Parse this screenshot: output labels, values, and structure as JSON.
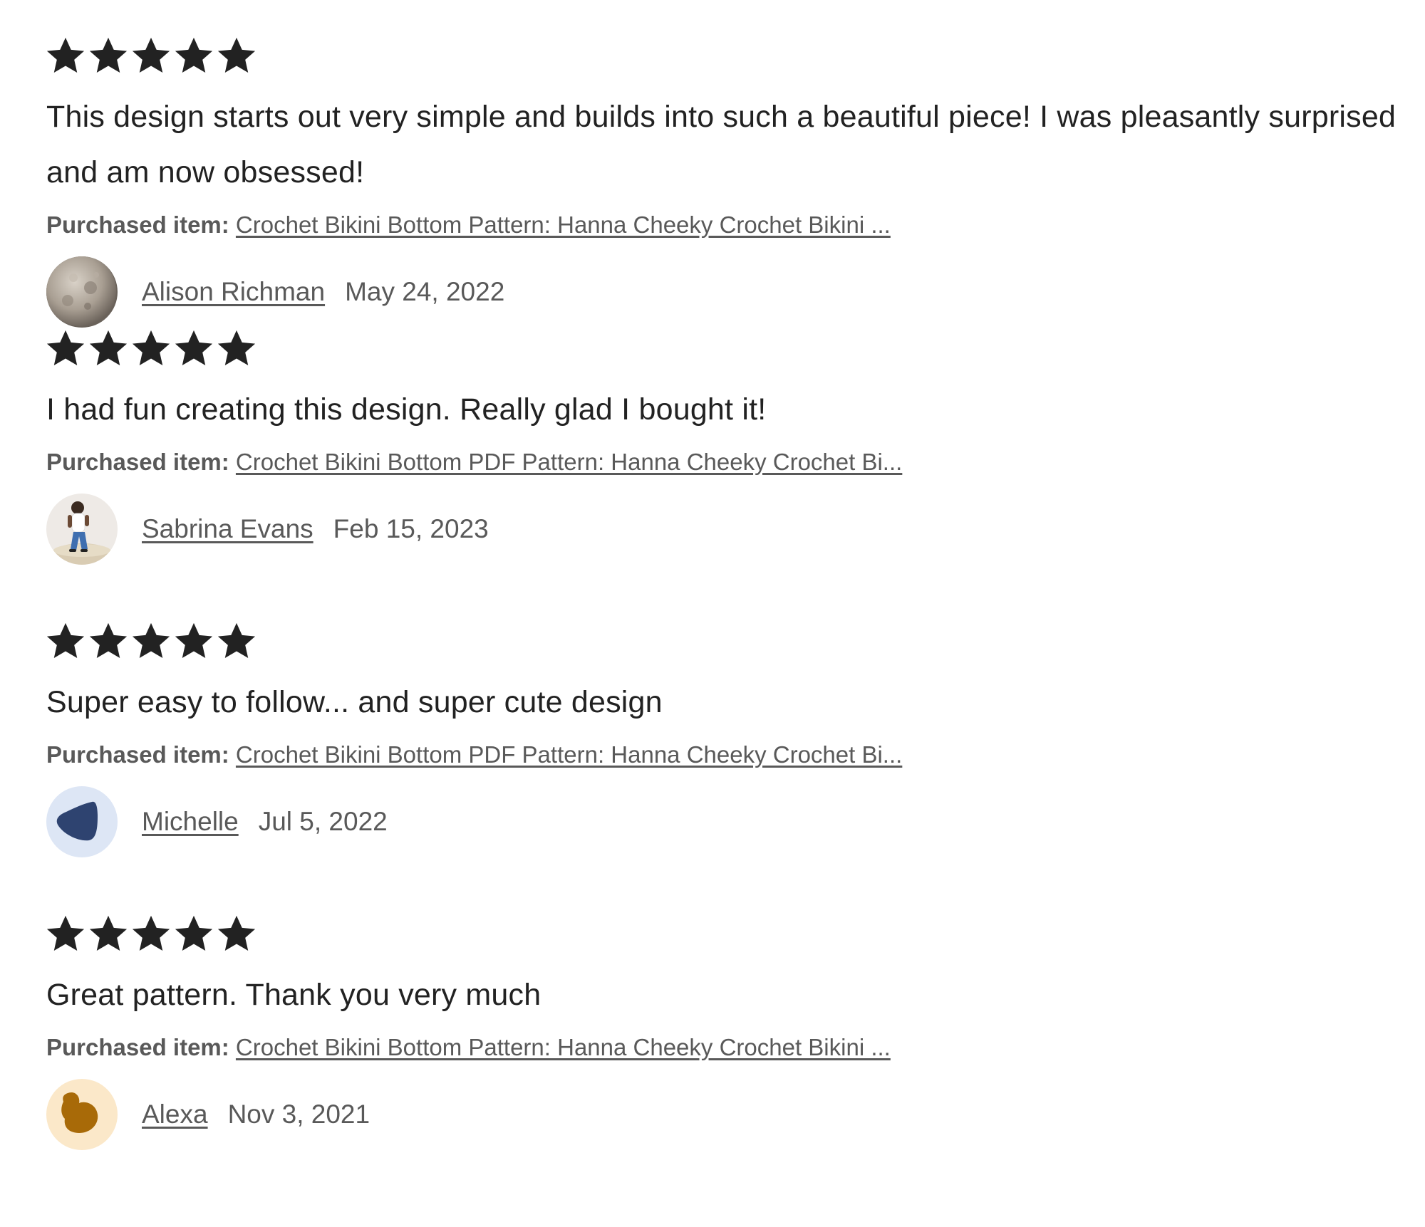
{
  "purchased_label": "Purchased item:",
  "colors": {
    "star": "#222222",
    "text": "#222222",
    "secondary": "#595959"
  },
  "reviews": [
    {
      "rating": 5,
      "text": "This design starts out very simple and builds into such a beautiful piece! I was pleasantly surprised and am now obsessed!",
      "purchased_item": "Crochet Bikini Bottom Pattern: Hanna Cheeky Crochet Bikini ...",
      "reviewer": "Alison Richman",
      "date": "May 24, 2022",
      "avatar": "moon-photo-avatar"
    },
    {
      "rating": 5,
      "text": "I had fun creating this design. Really glad I bought it!",
      "purchased_item": "Crochet Bikini Bottom PDF Pattern: Hanna Cheeky Crochet Bi...",
      "reviewer": "Sabrina Evans",
      "date": "Feb 15, 2023",
      "avatar": "person-photo-avatar"
    },
    {
      "rating": 5,
      "text": "Super easy to follow... and super cute design",
      "purchased_item": "Crochet Bikini Bottom PDF Pattern: Hanna Cheeky Crochet Bi...",
      "reviewer": "Michelle",
      "date": "Jul 5, 2022",
      "avatar": "blue-blob-avatar"
    },
    {
      "rating": 5,
      "text": "Great pattern. Thank you very much",
      "purchased_item": "Crochet Bikini Bottom Pattern: Hanna Cheeky Crochet Bikini ...",
      "reviewer": "Alexa",
      "date": "Nov 3, 2021",
      "avatar": "brown-blob-avatar"
    }
  ]
}
